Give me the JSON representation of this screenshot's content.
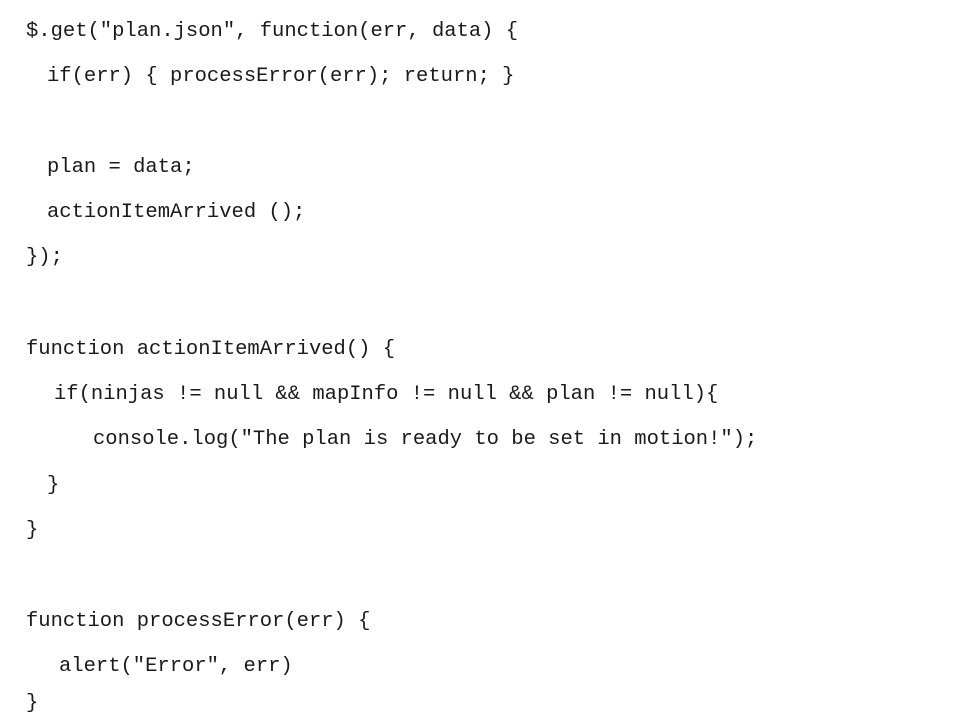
{
  "code": {
    "lines": [
      "$.get(\"plan.json\", function(err, data) {",
      "if(err) { processError(err); return; }",
      "plan = data;",
      "actionItemArrived ();",
      "});",
      "function actionItemArrived() {",
      "if(ninjas != null && mapInfo != null && plan != null){",
      "console.log(\"The plan is ready to be set in motion!\");",
      "}",
      "}",
      "function processError(err) {",
      "alert(\"Error\", err)",
      "}"
    ]
  }
}
